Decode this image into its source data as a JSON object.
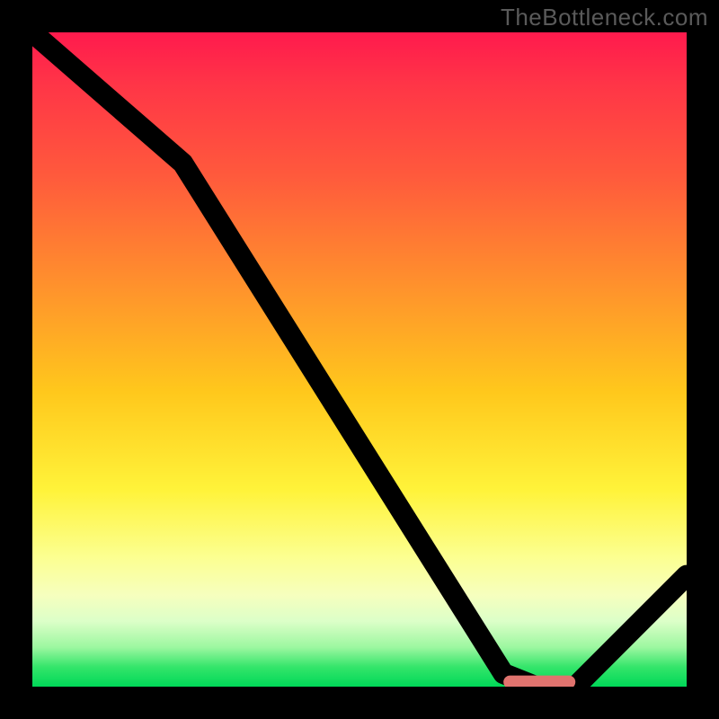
{
  "watermark": "TheBottleneck.com",
  "chart_data": {
    "type": "line",
    "title": "",
    "xlabel": "",
    "ylabel": "",
    "xlim": [
      0,
      100
    ],
    "ylim": [
      0,
      100
    ],
    "grid": false,
    "legend": false,
    "background": "vertical-gradient-red-to-green",
    "series": [
      {
        "name": "bottleneck-curve",
        "x": [
          0,
          23,
          72,
          77,
          83,
          100
        ],
        "values": [
          100,
          80,
          2,
          0,
          0,
          17
        ]
      }
    ],
    "marker": {
      "name": "optimal-range",
      "shape": "rounded-rect",
      "x_start": 72,
      "x_end": 83,
      "y": 0,
      "color": "#e0736e"
    },
    "gradient_stops": [
      {
        "pos": 0,
        "color": "#ff1a4d"
      },
      {
        "pos": 8,
        "color": "#ff3547"
      },
      {
        "pos": 22,
        "color": "#ff5a3c"
      },
      {
        "pos": 38,
        "color": "#ff8f2d"
      },
      {
        "pos": 55,
        "color": "#ffc81c"
      },
      {
        "pos": 70,
        "color": "#fff33a"
      },
      {
        "pos": 80,
        "color": "#fcff8f"
      },
      {
        "pos": 86,
        "color": "#f6ffbe"
      },
      {
        "pos": 90,
        "color": "#dcffc8"
      },
      {
        "pos": 94,
        "color": "#9cf7a0"
      },
      {
        "pos": 97,
        "color": "#34e56a"
      },
      {
        "pos": 100,
        "color": "#00d858"
      }
    ]
  }
}
